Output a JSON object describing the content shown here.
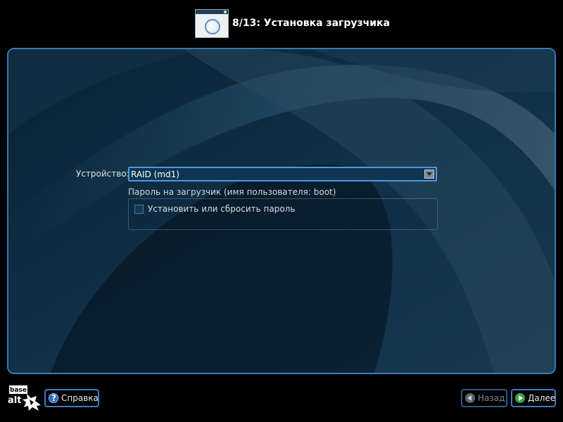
{
  "header": {
    "step_title": "8/13: Установка загрузчика",
    "step_icon": "installer-window-icon"
  },
  "form": {
    "device_label": "Устройство:",
    "device_value": "RAID (md1)",
    "password_caption": "Пароль на загрузчик (имя пользователя: boot)",
    "set_password_label": "Установить или сбросить пароль",
    "set_password_checked": false
  },
  "footer": {
    "logo_text_top": "base",
    "logo_text_bottom": "alt",
    "help_label": "Справка",
    "back_label": "Назад",
    "back_enabled": false,
    "next_label": "Далее"
  },
  "colors": {
    "accent_border": "#3a78b8",
    "panel_background": "#0e2638",
    "select_focus": "#4f98e0",
    "next_icon": "#3aa245",
    "help_icon": "#2e6ac4"
  }
}
